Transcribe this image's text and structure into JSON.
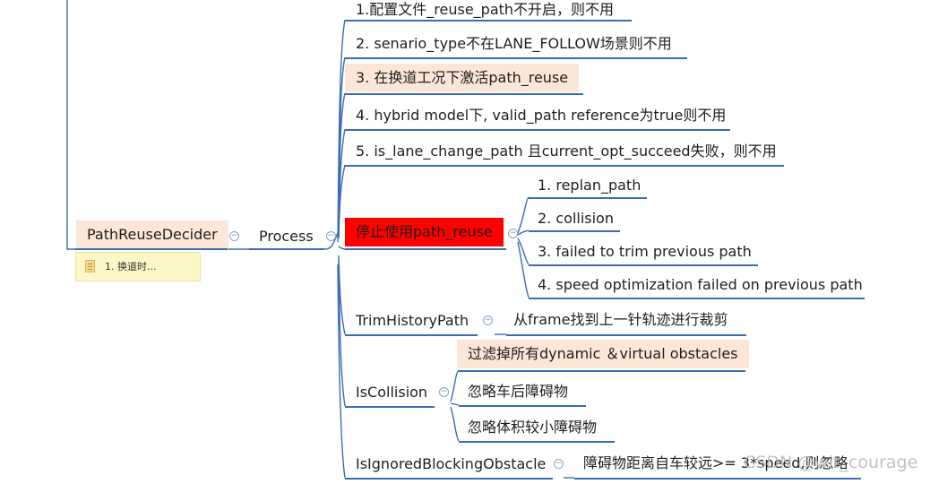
{
  "root": {
    "label": "PathReuseDecider",
    "note": "1. 换道时..."
  },
  "process": {
    "label": "Process"
  },
  "conditions": [
    {
      "label": "1.配置文件_reuse_path不开启，则不用"
    },
    {
      "label": "2. senario_type不在LANE_FOLLOW场景则不用"
    },
    {
      "label": "3. 在换道工况下激活path_reuse"
    },
    {
      "label": "4. hybrid model下, valid_path reference为true则不用"
    },
    {
      "label": "5. is_lane_change_path 且current_opt_succeed失败，则不用"
    }
  ],
  "stop": {
    "label": "停止使用path_reuse",
    "children": [
      {
        "label": "1. replan_path"
      },
      {
        "label": "2. collision"
      },
      {
        "label": "3. failed to trim previous path"
      },
      {
        "label": "4. speed optimization failed on previous path"
      }
    ]
  },
  "trim": {
    "label": "TrimHistoryPath",
    "child": "从frame找到上一针轨迹进行裁剪"
  },
  "collision": {
    "label": "IsCollision",
    "children": [
      {
        "label": "过滤掉所有dynamic ＆virtual obstacles"
      },
      {
        "label": "忽略车后障碍物"
      },
      {
        "label": "忽略体积较小障碍物"
      }
    ]
  },
  "ignored": {
    "label": "IsIgnoredBlockingObstacle",
    "child": "障碍物距离自车较远>= 3*speed,则忽略"
  },
  "watermark": "CSDN @wit_courage",
  "colors": {
    "line": "#3b6db3",
    "highlight": "#fbe6d8",
    "stop": "#ff0000",
    "note": "#fdf6c6"
  }
}
